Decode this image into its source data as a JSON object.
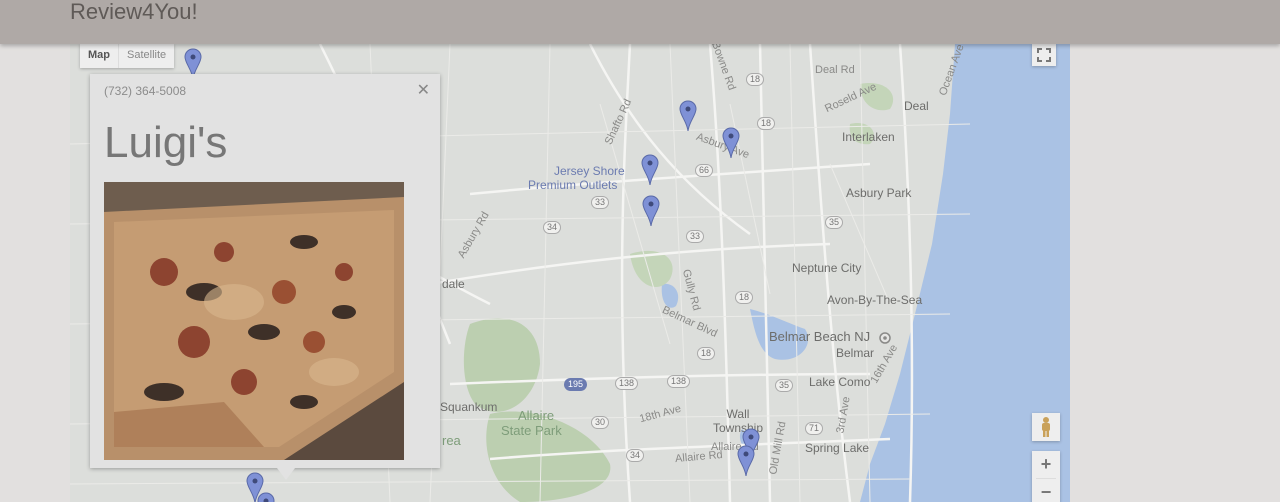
{
  "header": {
    "brand": "Review4You!"
  },
  "map": {
    "map_type": {
      "map_label": "Map",
      "satellite_label": "Satellite",
      "selected": "Map"
    },
    "controls": {
      "fullscreen_icon": "fullscreen-icon",
      "pegman_icon": "pegman-icon",
      "zoom_in_label": "+",
      "zoom_out_label": "−"
    },
    "places": [
      "Deal",
      "Interlaken",
      "Asbury Park",
      "Neptune City",
      "Avon-By-The-Sea",
      "Belmar",
      "Lake Como",
      "Wall Township",
      "Spring Lake",
      "Squankum",
      "dale"
    ],
    "roads": [
      "Deal Rd",
      "Roseld Ave",
      "Ocean Ave",
      "Bowne Rd",
      "Asbury Ave",
      "Shafto Rd",
      "Asbury Rd",
      "Gully Rd",
      "Belmar Blvd",
      "18th Ave",
      "Allaire Rd",
      "Old Mill Rd",
      "Allaire Rd",
      "3rd Ave",
      "16th Ave"
    ],
    "route_shields": [
      "18",
      "18",
      "66",
      "33",
      "33",
      "35",
      "34",
      "18",
      "18",
      "138",
      "138",
      "35",
      "195",
      "71",
      "30",
      "34"
    ],
    "pois": {
      "outlets_line1": "Jersey Shore",
      "outlets_line2": "Premium Outlets",
      "beach": "Belmar Beach NJ"
    },
    "parks": {
      "allaire_line1": "Allaire",
      "allaire_line2": "State Park",
      "area_fragment": "rea"
    },
    "marker_icon": "map-pin-icon",
    "info_window": {
      "phone": "(732) 364-5008",
      "title": "Luigi's",
      "image": "pizza-photo",
      "close_icon": "close-icon"
    }
  },
  "colors": {
    "header": "#afa9a6",
    "page_background": "#e2e0df",
    "water": "#aac2e4",
    "park": "#bccfb0",
    "marker": "#7f91d6",
    "info_window": "#e2e2e2"
  }
}
